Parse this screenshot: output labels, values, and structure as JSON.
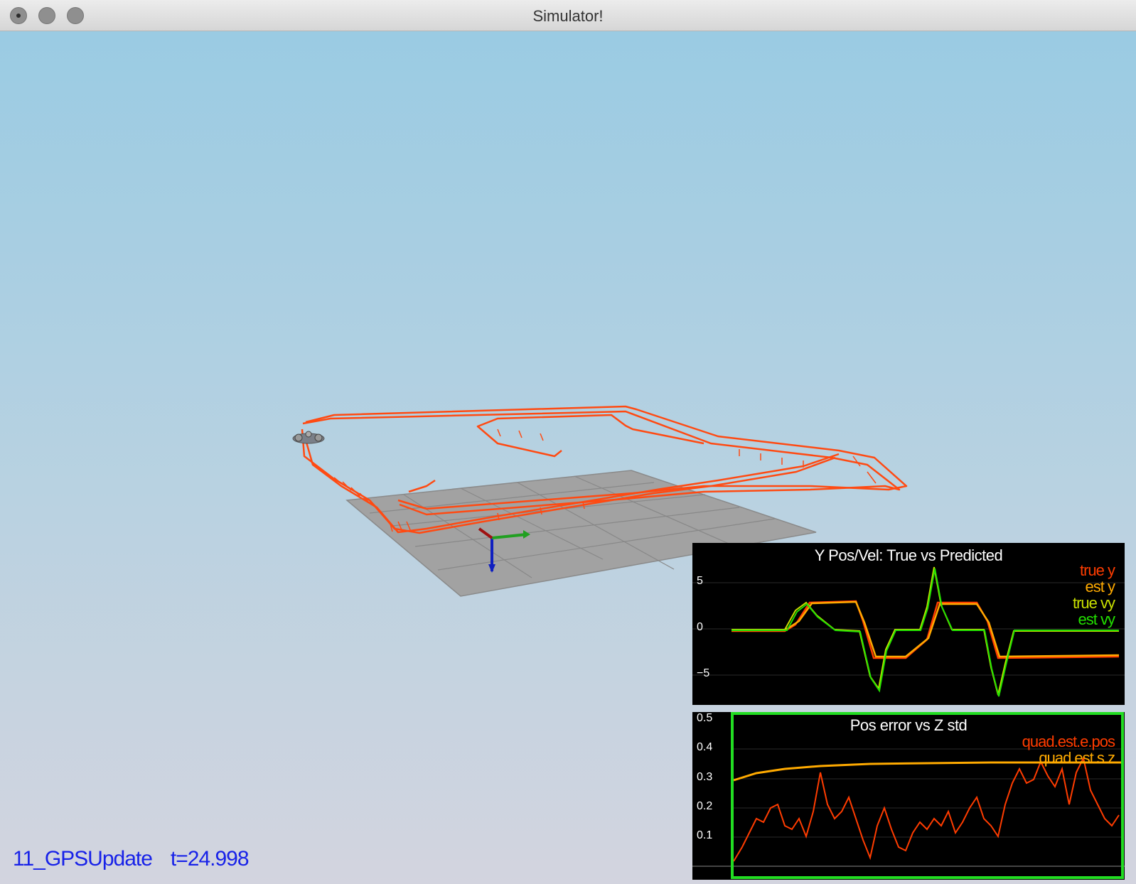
{
  "window": {
    "title": "Simulator!"
  },
  "scenario": {
    "name": "11_GPSUpdate",
    "time": "t=24.998"
  },
  "colors": {
    "trajectory": "#ff4a12",
    "true_y": "#ff3c00",
    "est_y": "#ffaa00",
    "true_vy": "#c8e000",
    "est_vy": "#22e000",
    "sky": "#9acbe3"
  },
  "plot1": {
    "title": "Y Pos/Vel: True vs Predicted",
    "legend": [
      "true y",
      "est y",
      "true vy",
      "est vy"
    ],
    "yticks": [
      "5",
      "0",
      "−5"
    ]
  },
  "plot2": {
    "title": "Pos error vs Z std",
    "legend": [
      "quad.est.e.pos",
      "quad.est.s.z"
    ],
    "yticks": [
      "0.5",
      "0.4",
      "0.3",
      "0.2",
      "0.1"
    ]
  }
}
